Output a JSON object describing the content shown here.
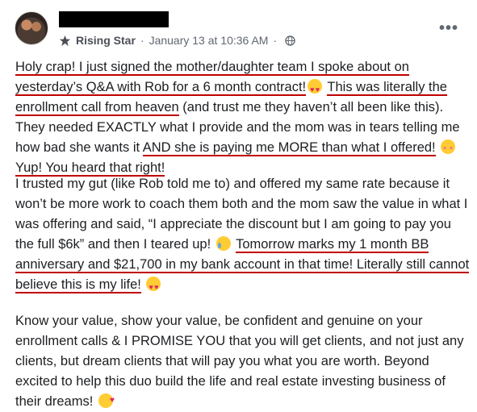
{
  "post": {
    "badge_label": "Rising Star",
    "separator": "·",
    "timestamp": "January 13 at 10:36 AM",
    "separator2": "·",
    "more_label": "•••",
    "p1": {
      "s1": "Holy crap! I just signed the mother/daughter team I spoke about on yesterday’s Q&A with Rob for a 6 month contract!",
      "s2": "This was literally the enrollment call from heaven",
      "s3": " (and trust me they haven’t all been like this). They needed EXACTLY what I provide and the mom was in tears telling me how bad she wants it ",
      "s4": "AND she is paying me MORE than what I offered!",
      "s5": "Yup! You heard that right!"
    },
    "p2": {
      "s1": "I trusted my gut (like Rob told me to) and offered my same rate because it won’t be more work to coach them both and the mom saw the value in what I was offering and said, “I appreciate the discount but I am going to pay you the full $6k” and then I teared up! ",
      "s2": "Tomorrow marks my 1 month BB anniversary and $21,700 in my bank account in that time! Literally still cannot believe this is my life!"
    },
    "p3": {
      "s1": "Know your value, show your value, be confident and genuine on your enrollment calls & I PROMISE YOU that you will get clients, and not just any clients, but dream clients that will pay you what you are worth. Beyond excited to help this duo build the life and real estate investing business of their dreams!"
    },
    "icons": [
      "avatar",
      "rising-star-badge-icon",
      "globe-icon",
      "more-options-icon",
      "heart-eyes-emoji",
      "flushed-emoji",
      "tear-emoji",
      "smiling-hearts-emoji"
    ],
    "colors": {
      "underline": "#c00000",
      "text": "#1c1e21",
      "meta": "#606770"
    }
  }
}
